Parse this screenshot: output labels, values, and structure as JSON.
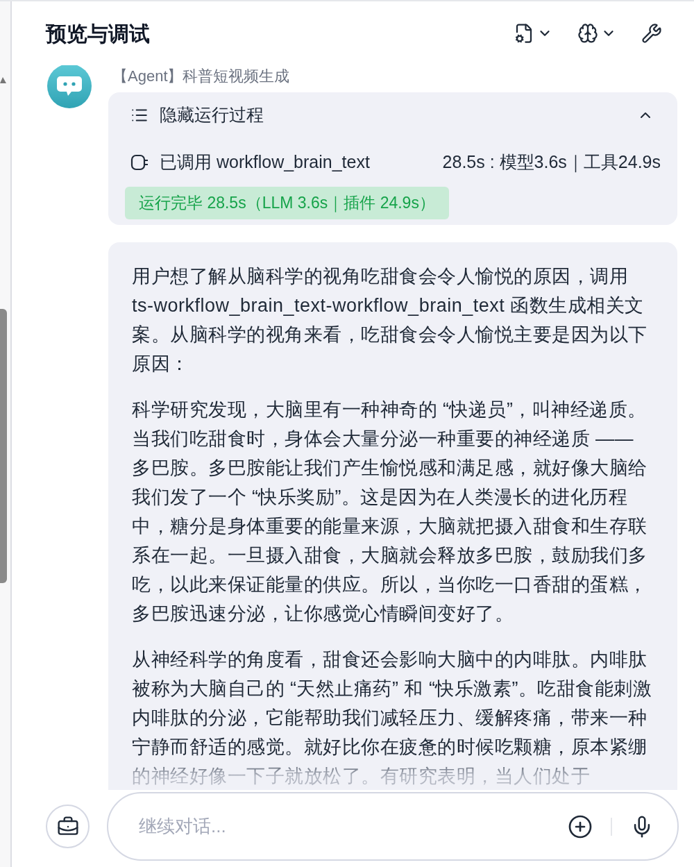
{
  "header": {
    "title": "预览与调试"
  },
  "agent": {
    "name": "【Agent】科普短视频生成"
  },
  "process": {
    "toggle_label": "隐藏运行过程",
    "expanded": true,
    "tool_call": {
      "label": "已调用 workflow_brain_text",
      "timing": "28.5s : 模型3.6s｜工具24.9s"
    },
    "status": "运行完毕 28.5s（LLM 3.6s｜插件 24.9s）"
  },
  "message": {
    "paragraphs": [
      "用户想了解从脑科学的视角吃甜食会令人愉悦的原因，调用 ts-workflow_brain_text-workflow_brain_text 函数生成相关文案。从脑科学的视角来看，吃甜食会令人愉悦主要是因为以下原因：",
      "科学研究发现，大脑里有一种神奇的 “快递员”，叫神经递质。当我们吃甜食时，身体会大量分泌一种重要的神经递质 —— 多巴胺。多巴胺能让我们产生愉悦感和满足感，就好像大脑给我们发了一个 “快乐奖励”。这是因为在人类漫长的进化历程中，糖分是身体重要的能量来源，大脑就把摄入甜食和生存联系在一起。一旦摄入甜食，大脑就会释放多巴胺，鼓励我们多吃，以此来保证能量的供应。所以，当你吃一口香甜的蛋糕，多巴胺迅速分泌，让你感觉心情瞬间变好了。",
      "从神经科学的角度看，甜食还会影响大脑中的内啡肽。内啡肽被称为大脑自己的 “天然止痛药” 和 “快乐激素”。吃甜食能刺激内啡肽的分泌，它能帮助我们减轻压力、缓解疼痛，带来一种宁静而舒适的感觉。就好比你在疲惫的时候吃颗糖，原本紧绷的神经好像一下子就放松了。有研究表明，当人们处于"
    ]
  },
  "input": {
    "placeholder": "继续对话..."
  }
}
